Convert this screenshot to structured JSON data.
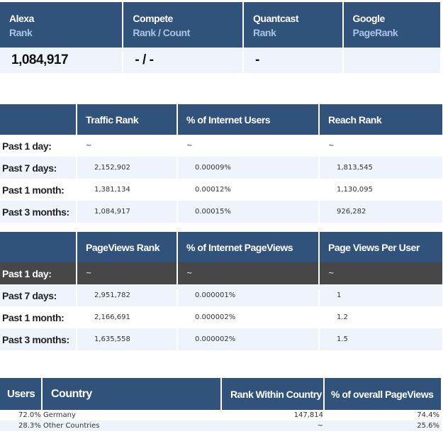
{
  "summary": {
    "columns": [
      {
        "title": "Alexa",
        "subtitle": "Rank",
        "value": "1,084,917"
      },
      {
        "title": "Compete",
        "subtitle": "Rank / Count",
        "value": "- / -"
      },
      {
        "title": "Quantcast",
        "subtitle": "Rank",
        "value": "-"
      },
      {
        "title": "Google",
        "subtitle": "PageRank",
        "value": ""
      }
    ]
  },
  "traffic": {
    "headers": [
      "",
      "Traffic Rank",
      "% of Internet Users",
      "Reach Rank"
    ],
    "rows": [
      {
        "label": "Past 1 day:",
        "rank": "~",
        "pct": "~",
        "reach": "~"
      },
      {
        "label": "Past 7 days:",
        "rank": "2,152,902",
        "pct": "0.00009%",
        "reach": "1,813,545"
      },
      {
        "label": "Past 1 month:",
        "rank": "1,381,134",
        "pct": "0.00012%",
        "reach": "1,130,095"
      },
      {
        "label": "Past 3 months:",
        "rank": "1,084,917",
        "pct": "0.00015%",
        "reach": "926,282"
      }
    ]
  },
  "pageviews": {
    "headers": [
      "",
      "PageViews Rank",
      "% of Internet PageViews",
      "Page Views Per User"
    ],
    "rows": [
      {
        "label": "Past 1 day:",
        "rank": "~",
        "pct": "~",
        "per_user": "~"
      },
      {
        "label": "Past 7 days:",
        "rank": "2,951,782",
        "pct": "0.000001%",
        "per_user": "1"
      },
      {
        "label": "Past 1 month:",
        "rank": "2,166,691",
        "pct": "0.000002%",
        "per_user": "1.2"
      },
      {
        "label": "Past 3 months:",
        "rank": "1,635,558",
        "pct": "0.000002%",
        "per_user": "1.5"
      }
    ]
  },
  "countries": {
    "headers": [
      "Users",
      "Country",
      "Rank Within Country",
      "% of overall PageViews"
    ],
    "rows": [
      {
        "users": "72.0%",
        "country": "Germany",
        "rank": "147,814",
        "pageviews": "74.4%"
      },
      {
        "users": "28.3%",
        "country": "Other Countries",
        "rank": "~",
        "pageviews": "25.6%"
      }
    ]
  },
  "colors": {
    "header_bg": "#30527b",
    "subtitle": "#a9c4e6",
    "alt_row": "#eff3fc",
    "highlight_row": "#474747"
  }
}
